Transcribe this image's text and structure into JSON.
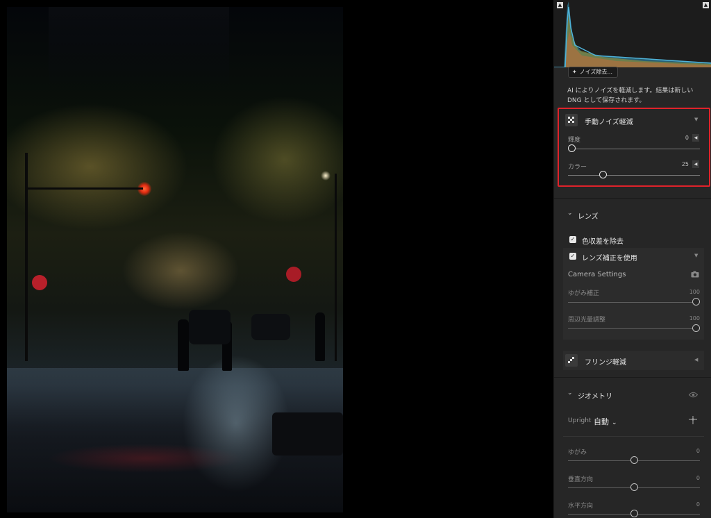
{
  "histogram": {
    "label": "histogram"
  },
  "ai_denoise": {
    "button_label": "ノイズ除去...",
    "description": "AI によりノイズを軽減します。結果は新しい DNG として保存されます。"
  },
  "manual_noise": {
    "title": "手動ノイズ軽減",
    "luminance": {
      "label": "輝度",
      "value": "0"
    },
    "color": {
      "label": "カラー",
      "value": "25"
    }
  },
  "lens": {
    "title": "レンズ",
    "remove_ca": "色収差を除去",
    "use_lens_correction": "レンズ補正を使用",
    "camera_settings": "Camera Settings",
    "distortion": {
      "label": "ゆがみ補正",
      "value": "100"
    },
    "vignetting": {
      "label": "周辺光量調整",
      "value": "100"
    }
  },
  "defringe": {
    "title": "フリンジ軽減"
  },
  "geometry": {
    "title": "ジオメトリ",
    "upright_label": "Upright",
    "upright_value": "自動",
    "distortion": {
      "label": "ゆがみ",
      "value": "0"
    },
    "vertical": {
      "label": "垂直方向",
      "value": "0"
    },
    "horizontal": {
      "label": "水平方向",
      "value": "0"
    }
  },
  "sliders": {
    "luminance": 0.0,
    "color": 0.25,
    "lens_distortion": 1.0,
    "lens_vignetting": 1.0,
    "geo_distortion": 0.0,
    "geo_vertical": 0.0,
    "geo_horizontal": 0.0
  }
}
